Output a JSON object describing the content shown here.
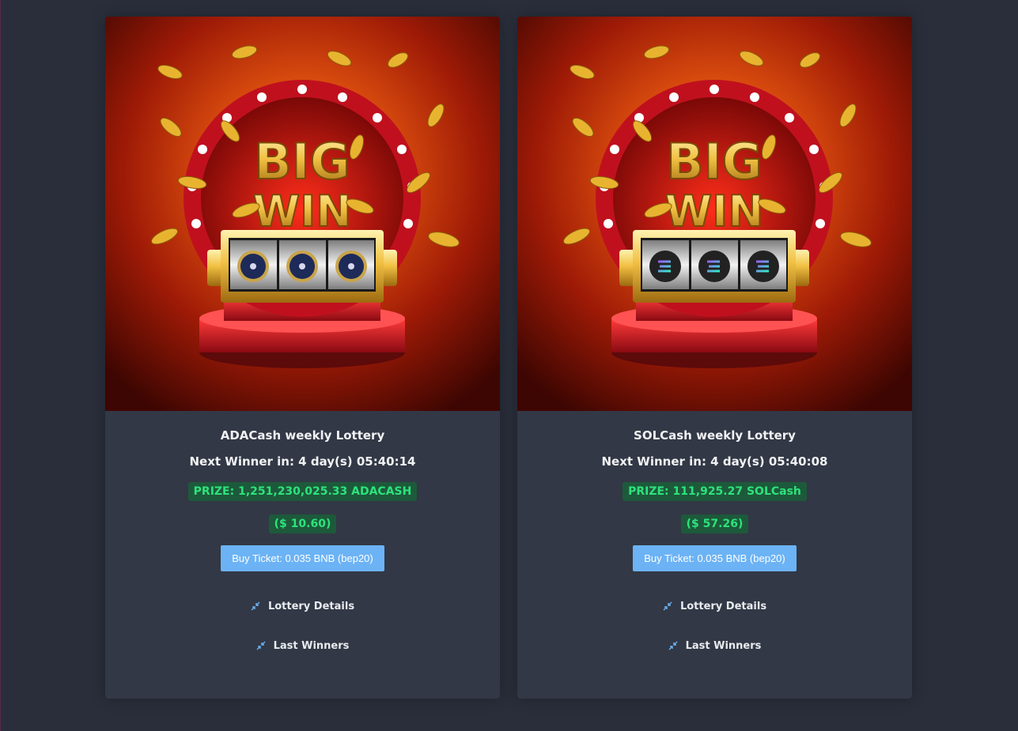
{
  "lotteries": [
    {
      "banner": {
        "line1": "BIG",
        "line2": "WIN",
        "coin": "adacash-coin"
      },
      "title": "ADACash weekly Lottery",
      "countdown": "Next Winner in: 4 day(s) 05:40:14",
      "prize": "PRIZE: 1,251,230,025.33 ADACASH",
      "usd": "($ 10.60)",
      "buy_label": "Buy Ticket: 0.035 BNB (bep20)",
      "details_label": "Lottery Details",
      "winners_label": "Last Winners"
    },
    {
      "banner": {
        "line1": "BIG",
        "line2": "WIN",
        "coin": "solcash-coin"
      },
      "title": "SOLCash weekly Lottery",
      "countdown": "Next Winner in: 4 day(s) 05:40:08",
      "prize": "PRIZE: 111,925.27 SOLCash",
      "usd": "($ 57.26)",
      "buy_label": "Buy Ticket: 0.035 BNB (bep20)",
      "details_label": "Lottery Details",
      "winners_label": "Last Winners"
    }
  ],
  "colors": {
    "page_bg": "#292e3a",
    "card_bg": "#323845",
    "prize_text": "#2ee27c",
    "prize_bg": "#1d5a3b",
    "button_bg": "#6cb3f5"
  },
  "icons": {
    "expand_links": "compress-arrows-icon"
  }
}
